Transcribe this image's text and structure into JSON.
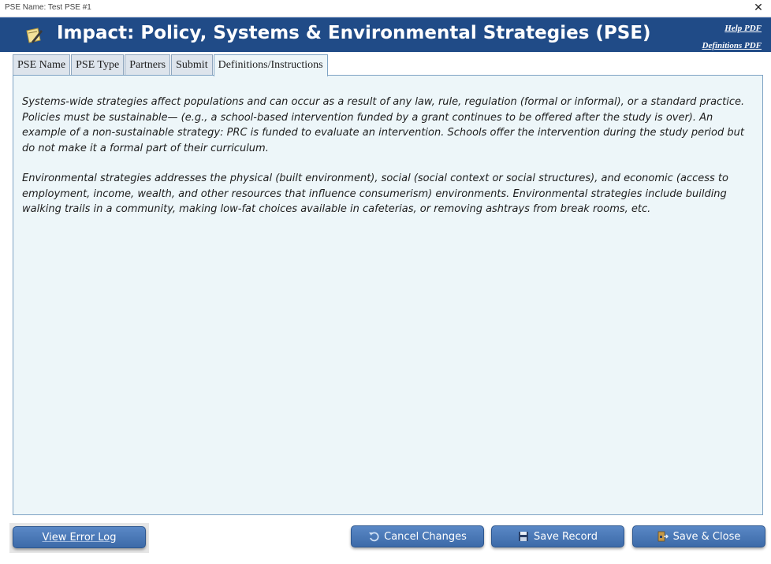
{
  "window": {
    "title": "PSE Name: Test PSE #1",
    "close_glyph": "✕"
  },
  "header": {
    "title": "Impact: Policy, Systems & Environmental Strategies (PSE)",
    "logo_icon": "note-pencil-icon",
    "help_link": "Help PDF",
    "definitions_link": "Definitions PDF",
    "background_color": "#204b87"
  },
  "tabs": [
    {
      "label": "PSE Name",
      "active": false
    },
    {
      "label": "PSE Type",
      "active": false
    },
    {
      "label": "Partners",
      "active": false
    },
    {
      "label": "Submit",
      "active": false
    },
    {
      "label": "Definitions/Instructions",
      "active": true
    }
  ],
  "content": {
    "paragraph1": "Systems-wide strategies affect populations and can occur as a result of any law, rule, regulation (formal or informal), or a standard practice. Policies must be sustainable— (e.g., a school-based intervention funded by a grant continues to be offered after the study is over). An example of a non-sustainable strategy: PRC is funded to evaluate an intervention. Schools offer the intervention during the study period but do not make it a formal part of their curriculum.",
    "paragraph2": "Environmental strategies addresses the physical (built environment), social (social context or social structures), and economic (access to employment, income, wealth, and other resources that influence consumerism) environments. Environmental strategies include building walking trails in a community, making low-fat choices available in cafeterias, or removing ashtrays from break rooms, etc."
  },
  "buttons": {
    "error_log": "View Error Log",
    "cancel": "Cancel Changes",
    "save": "Save Record",
    "save_close": "Save & Close"
  }
}
